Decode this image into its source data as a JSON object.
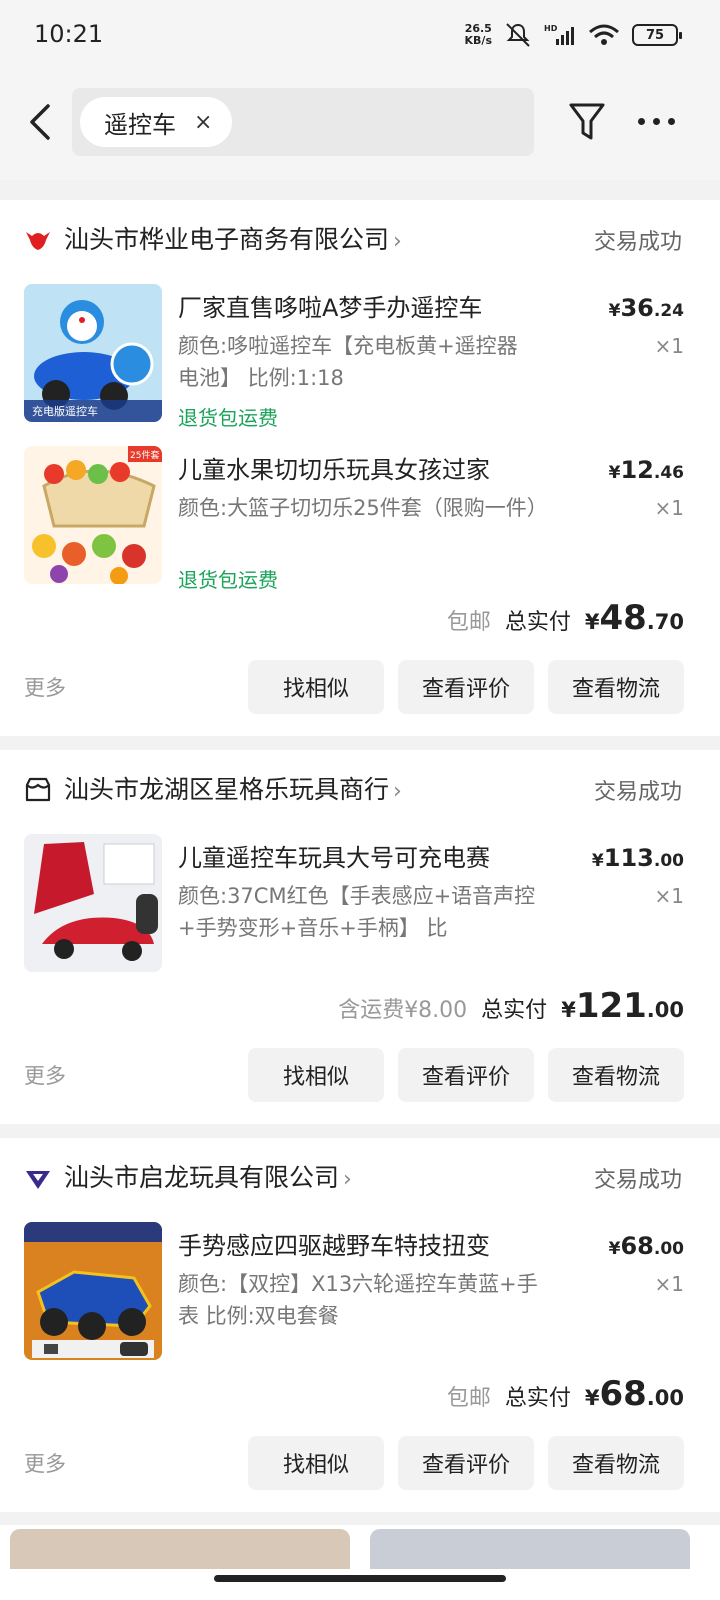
{
  "status_bar": {
    "time": "10:21",
    "net_speed": "26.5",
    "net_unit": "KB/s",
    "battery": "75",
    "signal_icon": "signal-hd-icon",
    "wifi_icon": "wifi-icon"
  },
  "search": {
    "chip_text": "遥控车",
    "clear_symbol": "×"
  },
  "icons": {
    "back": "back-arrow-icon",
    "filter": "filter-icon",
    "more": "more-dots-icon"
  },
  "orders": [
    {
      "shop_name": "汕头市桦业电子商务有限公司",
      "status": "交易成功",
      "items": [
        {
          "title": "厂家直售哆啦A梦手办遥控车",
          "spec": "颜色:哆啦遥控车【充电板黄+遥控器电池】 比例:1:18",
          "price_int": "36",
          "price_dec": ".24",
          "qty": "×1",
          "tag": "退货包运费",
          "thumb_label": "充电版遥控车"
        },
        {
          "title": "儿童水果切切乐玩具女孩过家",
          "spec": "颜色:大篮子切切乐25件套（限购一件）",
          "price_int": "12",
          "price_dec": ".46",
          "qty": "×1",
          "tag": "退货包运费",
          "thumb_label": "25件套"
        }
      ],
      "shipping": "包邮",
      "total_label": "总实付",
      "total_int": "48",
      "total_dec": ".70"
    },
    {
      "shop_name": "汕头市龙湖区星格乐玩具商行",
      "status": "交易成功",
      "items": [
        {
          "title": "儿童遥控车玩具大号可充电赛",
          "spec": "颜色:37CM红色【手表感应+语音声控+手势变形+音乐+手柄】 比",
          "price_int": "113",
          "price_dec": ".00",
          "qty": "×1",
          "tag": "",
          "thumb_label": ""
        }
      ],
      "shipping": "含运费¥8.00",
      "total_label": "总实付",
      "total_int": "121",
      "total_dec": ".00"
    },
    {
      "shop_name": "汕头市启龙玩具有限公司",
      "status": "交易成功",
      "items": [
        {
          "title": "手势感应四驱越野车特技扭变",
          "spec": "颜色:【双控】X13六轮遥控车黄蓝+手表 比例:双电套餐",
          "price_int": "68",
          "price_dec": ".00",
          "qty": "×1",
          "tag": "",
          "thumb_label": ""
        }
      ],
      "shipping": "包邮",
      "total_label": "总实付",
      "total_int": "68",
      "total_dec": ".00"
    }
  ],
  "actions": {
    "more": "更多",
    "similar": "找相似",
    "review": "查看评价",
    "logistics": "查看物流"
  },
  "currency": "¥",
  "colors": {
    "tag_green": "#1aa35a",
    "shop1_icon": "#e02020",
    "shop3_icon": "#3a2a8c"
  }
}
